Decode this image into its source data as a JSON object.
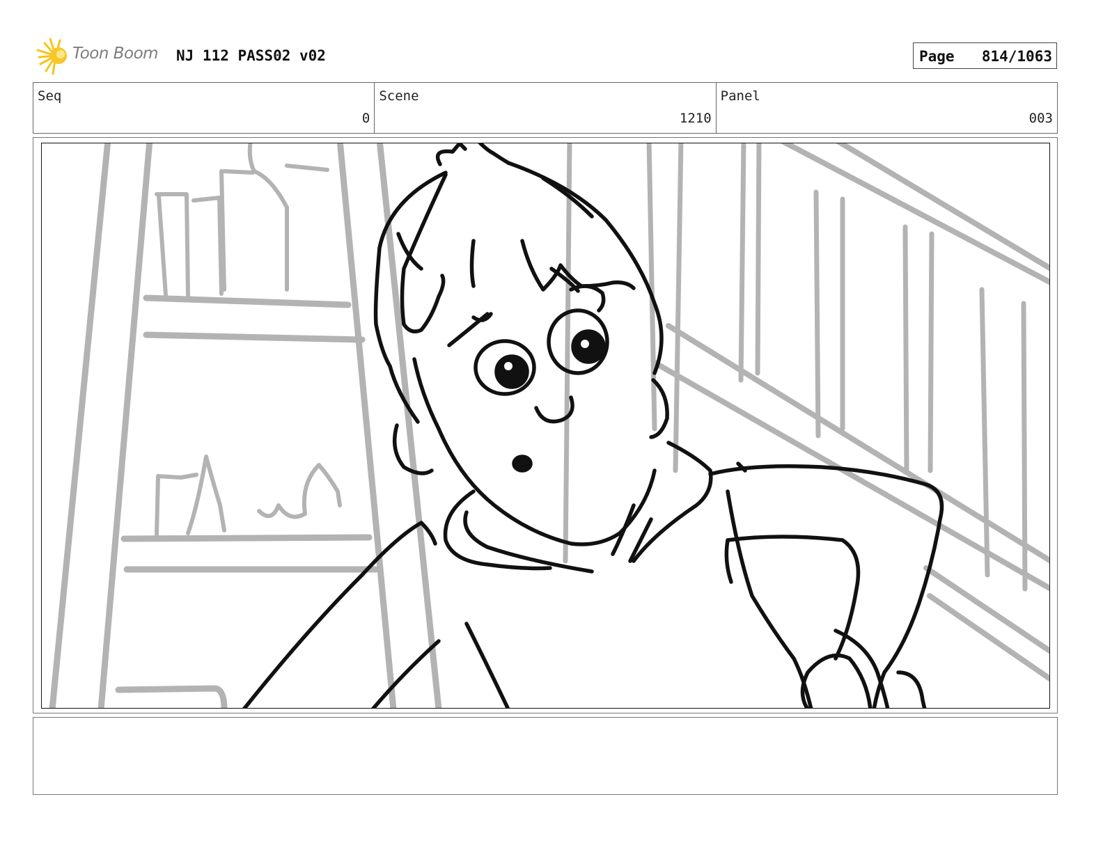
{
  "header": {
    "logo_text": "Toon Boom",
    "doc_title": "NJ 112 PASS02 v02",
    "page_label": "Page",
    "page_value": "814/1063"
  },
  "info": {
    "seq_label": "Seq",
    "seq_value": "0",
    "scene_label": "Scene",
    "scene_value": "1210",
    "panel_label": "Panel",
    "panel_value": "003"
  },
  "icons": {
    "logo": "toon-boom-starburst-icon"
  },
  "colors": {
    "logo_yellow": "#f5c518",
    "logo_text": "#7d7d7d",
    "sketch_gray": "#b3b3b3",
    "ink": "#111111"
  },
  "notes": ""
}
